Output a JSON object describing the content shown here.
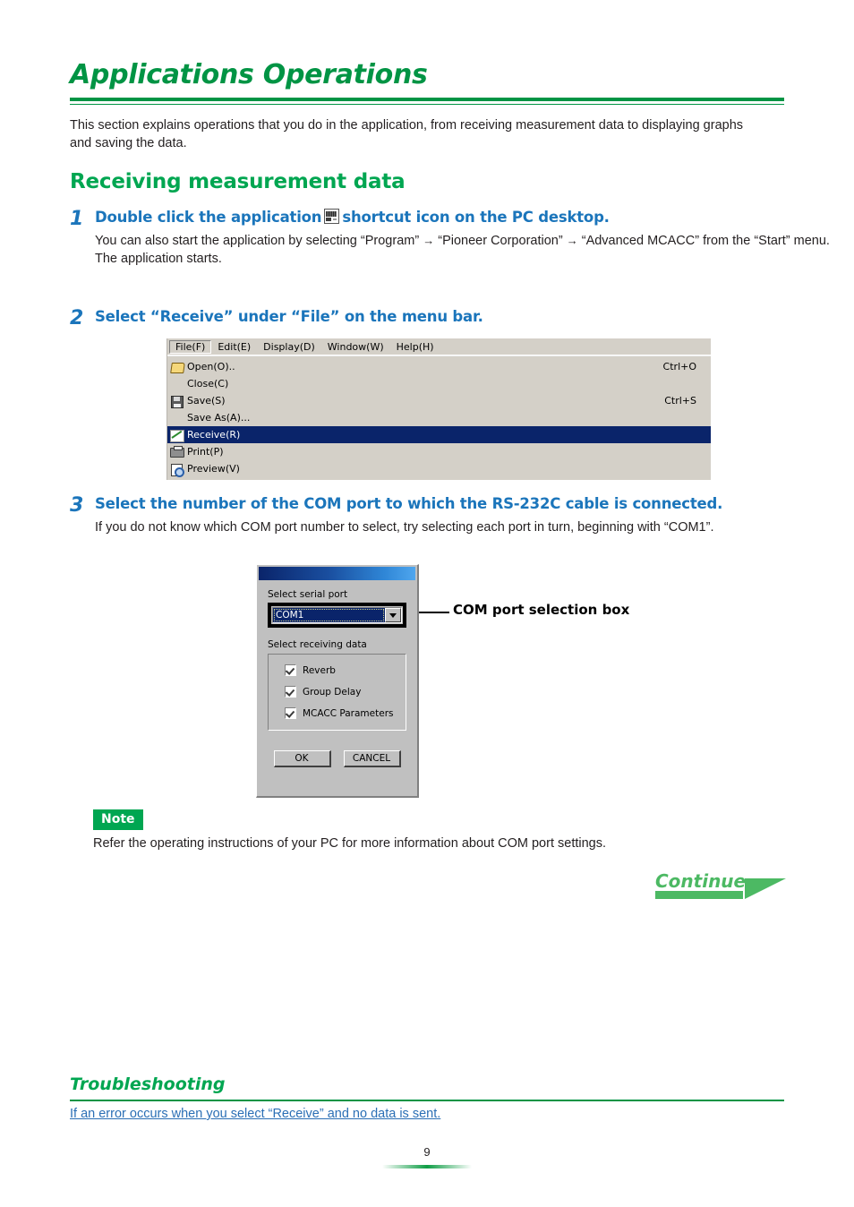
{
  "page": {
    "title": "Applications Operations",
    "intro": "This section explains operations that you do in the application, from receiving measurement data to displaying graphs and saving the data.",
    "page_number": "9"
  },
  "section": {
    "heading": "Receiving measurement data"
  },
  "steps": [
    {
      "number": "1",
      "title_part1": "Double click the application",
      "icon": "app-shortcut-icon",
      "title_part2": "shortcut icon on the PC desktop.",
      "body_line1_a": "You can also start the application by selecting “Program”",
      "arrow1": "→",
      "body_line1_b": "“Pioneer Corporation”",
      "arrow2": "→",
      "body_line1_c": "“Advanced MCACC” from the “Start” menu.",
      "body_line2": "The application starts."
    },
    {
      "number": "2",
      "title": "Select “Receive” under “File” on the menu bar."
    },
    {
      "number": "3",
      "title": "Select the number of the COM port to which the RS-232C cable is connected.",
      "body": "If you do not know which COM port number to select, try selecting each port in turn, beginning with “COM1”."
    }
  ],
  "menu_screenshot": {
    "menubar": [
      {
        "label": "File(F)",
        "active": true
      },
      {
        "label": "Edit(E)",
        "active": false
      },
      {
        "label": "Display(D)",
        "active": false
      },
      {
        "label": "Window(W)",
        "active": false
      },
      {
        "label": "Help(H)",
        "active": false
      }
    ],
    "file_menu": [
      {
        "label": "Open(O)..",
        "accel": "Ctrl+O",
        "icon": "folder-open-icon",
        "highlighted": false
      },
      {
        "label": "Close(C)",
        "accel": "",
        "icon": "",
        "highlighted": false
      },
      {
        "label": "Save(S)",
        "accel": "Ctrl+S",
        "icon": "floppy-disk-icon",
        "highlighted": false
      },
      {
        "label": "Save As(A)...",
        "accel": "",
        "icon": "",
        "highlighted": false
      },
      {
        "label": "Receive(R)",
        "accel": "",
        "icon": "graph-line-icon",
        "highlighted": true
      },
      {
        "label": "Print(P)",
        "accel": "",
        "icon": "printer-icon",
        "highlighted": false
      },
      {
        "label": "Preview(V)",
        "accel": "",
        "icon": "preview-magnifier-icon",
        "highlighted": false
      }
    ]
  },
  "com_dialog": {
    "serial_port_label": "Select serial port",
    "serial_port_value": "COM1",
    "receiving_data_label": "Select receiving data",
    "checkboxes": [
      {
        "label": "Reverb",
        "checked": true
      },
      {
        "label": "Group Delay",
        "checked": true
      },
      {
        "label": "MCACC Parameters",
        "checked": true
      }
    ],
    "ok_label": "OK",
    "cancel_label": "CANCEL",
    "callout_label": "COM port selection box"
  },
  "note": {
    "badge": "Note",
    "text": "Refer the operating instructions of your PC for more information about COM port settings."
  },
  "continue": {
    "label": "Continue"
  },
  "troubleshooting": {
    "heading": "Troubleshooting",
    "link": "If an error occurs when you select “Receive” and no data is sent."
  },
  "colors": {
    "green_title": "#009444",
    "green_heading": "#00a651",
    "blue_step": "#1b75bb",
    "link_blue": "#2b6fb5",
    "menu_highlight": "#0a246a",
    "continue_green": "#4cb963"
  }
}
